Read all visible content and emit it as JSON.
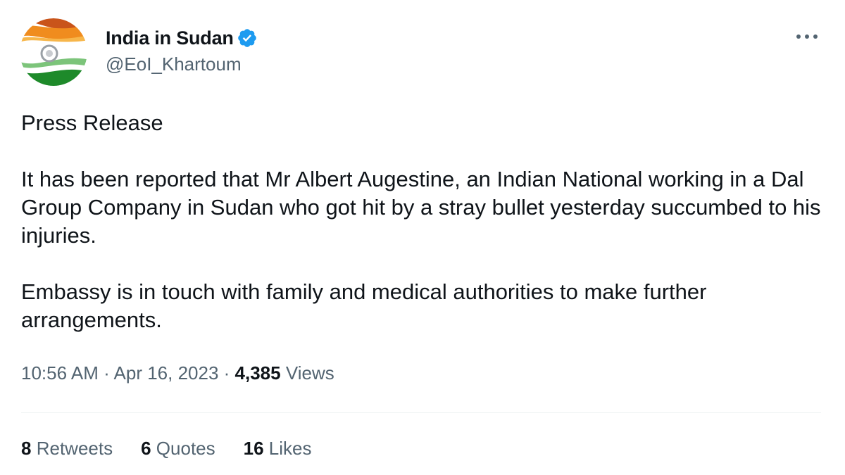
{
  "account": {
    "display_name": "India in Sudan",
    "handle": "@EoI_Khartoum",
    "verified": true,
    "avatar_icon": "india-flag-avatar-icon",
    "verified_icon": "verified-badge-icon"
  },
  "menu": {
    "more_icon": "more-options-icon"
  },
  "tweet": {
    "title": "Press Release",
    "paragraph_1": "It has been reported that Mr Albert Augestine, an Indian National working in a Dal Group Company in Sudan who got hit by a stray bullet yesterday succumbed to his injuries.",
    "paragraph_2": "Embassy is in touch with family and medical authorities to make further arrangements."
  },
  "meta": {
    "time": "10:56 AM",
    "separator": " · ",
    "date": "Apr 16, 2023",
    "views_count": "4,385",
    "views_label": "Views"
  },
  "stats": {
    "retweets_count": "8",
    "retweets_label": "Retweets",
    "quotes_count": "6",
    "quotes_label": "Quotes",
    "likes_count": "16",
    "likes_label": "Likes"
  },
  "colors": {
    "text_primary": "#0f1419",
    "text_secondary": "#536471",
    "verified_blue": "#1d9bf0",
    "divider": "#eff3f4",
    "saffron": "#f08c1e",
    "green": "#1e8a2a",
    "chakra_navy": "#1b2a6b"
  }
}
